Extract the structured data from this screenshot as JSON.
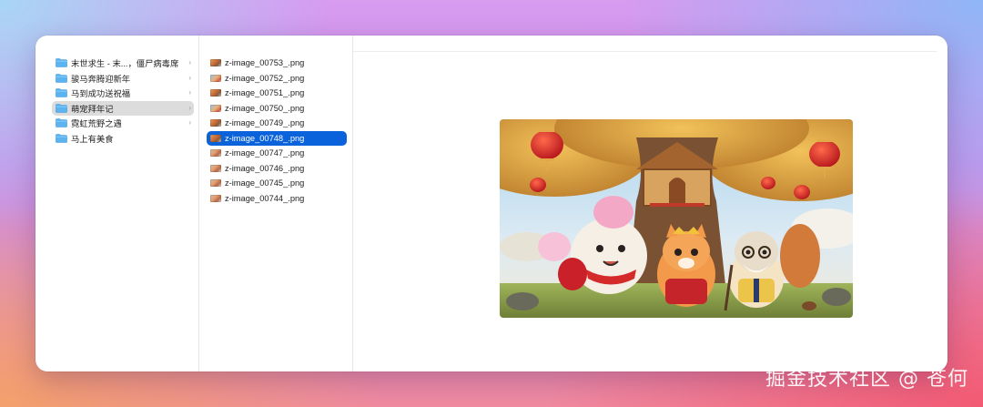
{
  "folders": [
    {
      "label": "末世求生 - 末...，僵尸病毒席",
      "selected": false
    },
    {
      "label": "骏马奔腾迎新年",
      "selected": false
    },
    {
      "label": "马到成功送祝福",
      "selected": false
    },
    {
      "label": "萌宠拜年记",
      "selected": true
    },
    {
      "label": "霓虹荒野之遇",
      "selected": false
    },
    {
      "label": "马上有美食",
      "selected": false
    }
  ],
  "files": [
    {
      "name": "z-image_00753_.png",
      "selected": false
    },
    {
      "name": "z-image_00752_.png",
      "selected": false
    },
    {
      "name": "z-image_00751_.png",
      "selected": false
    },
    {
      "name": "z-image_00750_.png",
      "selected": false
    },
    {
      "name": "z-image_00749_.png",
      "selected": false
    },
    {
      "name": "z-image_00748_.png",
      "selected": true
    },
    {
      "name": "z-image_00747_.png",
      "selected": false
    },
    {
      "name": "z-image_00746_.png",
      "selected": false
    },
    {
      "name": "z-image_00745_.png",
      "selected": false
    },
    {
      "name": "z-image_00744_.png",
      "selected": false
    }
  ],
  "chevron_glyph": "›",
  "watermark": "掘金技术社区 @ 苍何",
  "colors": {
    "selection_blue": "#0a63db",
    "folder_selected_gray": "#dcdcdc",
    "folder_icon": "#4aa8ec"
  },
  "icons": {
    "folder": "folder-icon",
    "file_thumbnail": "image-thumbnail-icon",
    "chevron": "chevron-right-icon"
  }
}
